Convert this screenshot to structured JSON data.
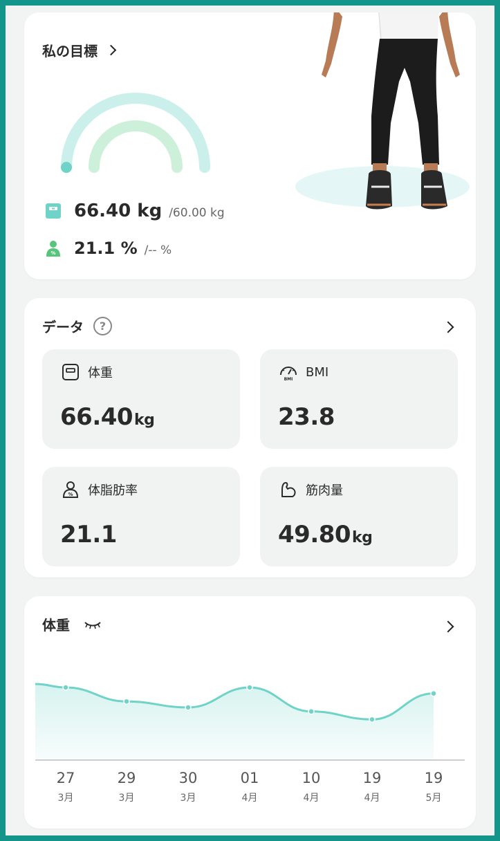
{
  "goal": {
    "title": "私の目標",
    "weight_value": "66.40 kg",
    "weight_target": "/60.00 kg",
    "fat_value": "21.1 %",
    "fat_target": "/-- %"
  },
  "data_section": {
    "title": "データ",
    "help_symbol": "?",
    "tiles": [
      {
        "label": "体重",
        "value": "66.40",
        "unit": "kg",
        "icon": "scale-icon"
      },
      {
        "label": "BMI",
        "value": "23.8",
        "unit": "",
        "icon": "bmi-gauge-icon"
      },
      {
        "label": "体脂肪率",
        "value": "21.1",
        "unit": "",
        "icon": "body-fat-icon"
      },
      {
        "label": "筋肉量",
        "value": "49.80",
        "unit": "kg",
        "icon": "muscle-arm-icon"
      }
    ]
  },
  "weight_chart": {
    "title": "体重",
    "eye_icon": "eye-closed-icon",
    "chart_data": {
      "type": "area",
      "title": "体重",
      "categories": [
        {
          "day": "27",
          "month": "3月"
        },
        {
          "day": "29",
          "month": "3月"
        },
        {
          "day": "30",
          "month": "3月"
        },
        {
          "day": "01",
          "month": "4月"
        },
        {
          "day": "10",
          "month": "4月"
        },
        {
          "day": "19",
          "month": "4月"
        },
        {
          "day": "19",
          "month": "5月"
        }
      ],
      "values": [
        67.6,
        66.9,
        66.6,
        67.6,
        66.4,
        66.0,
        67.3
      ],
      "ylim": [
        64.0,
        68.5
      ],
      "grid": false,
      "color": "#6fd3c8"
    }
  },
  "colors": {
    "accent": "#6fd3c8",
    "gauge_outer": "#cbf0ec",
    "gauge_inner": "#cdf0da",
    "fat_icon": "#57c47c"
  }
}
